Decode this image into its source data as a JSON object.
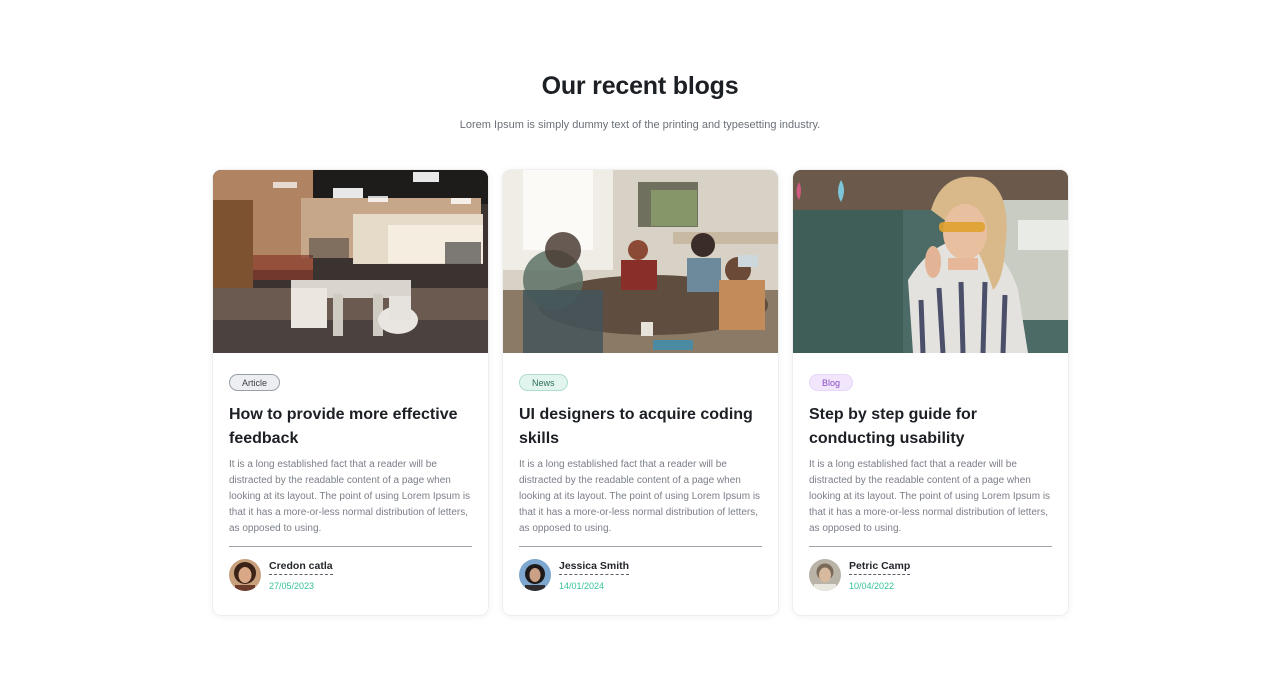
{
  "section": {
    "title": "Our recent blogs",
    "subtitle": "Lorem Ipsum is simply dummy text of the printing and typesetting industry."
  },
  "posts": [
    {
      "tag": "Article",
      "title": "How to provide more effective feedback",
      "excerpt": "It is a long established fact that a reader will be distracted by the readable content of a page when looking at its layout. The point of using Lorem Ipsum is that it has a more-or-less normal distribution of letters, as opposed to using.",
      "author": "Credon catla",
      "date": "27/05/2023",
      "image_alt": "Open-plan office interior"
    },
    {
      "tag": "News",
      "title": "UI designers to acquire coding skills",
      "excerpt": "It is a long established fact that a reader will be distracted by the readable content of a page when looking at its layout. The point of using Lorem Ipsum is that it has a more-or-less normal distribution of letters, as opposed to using.",
      "author": "Jessica Smith",
      "date": "14/01/2024",
      "image_alt": "Team meeting around a table"
    },
    {
      "tag": "Blog",
      "title": "Step by step guide for conducting usability",
      "excerpt": "It is a long established fact that a reader will be distracted by the readable content of a page when looking at its layout. The point of using Lorem Ipsum is that it has a more-or-less normal distribution of letters, as opposed to using.",
      "author": "Petric Camp",
      "date": "10/04/2022",
      "image_alt": "Woman with sunglasses in a street"
    }
  ],
  "colors": {
    "title": "#1c1f24",
    "body_text": "#7a7f87",
    "date_accent": "#37c29a",
    "tag_article_bg": "#eceef1",
    "tag_news_bg": "#e2f4ee",
    "tag_blog_bg": "#f1e6fb"
  }
}
